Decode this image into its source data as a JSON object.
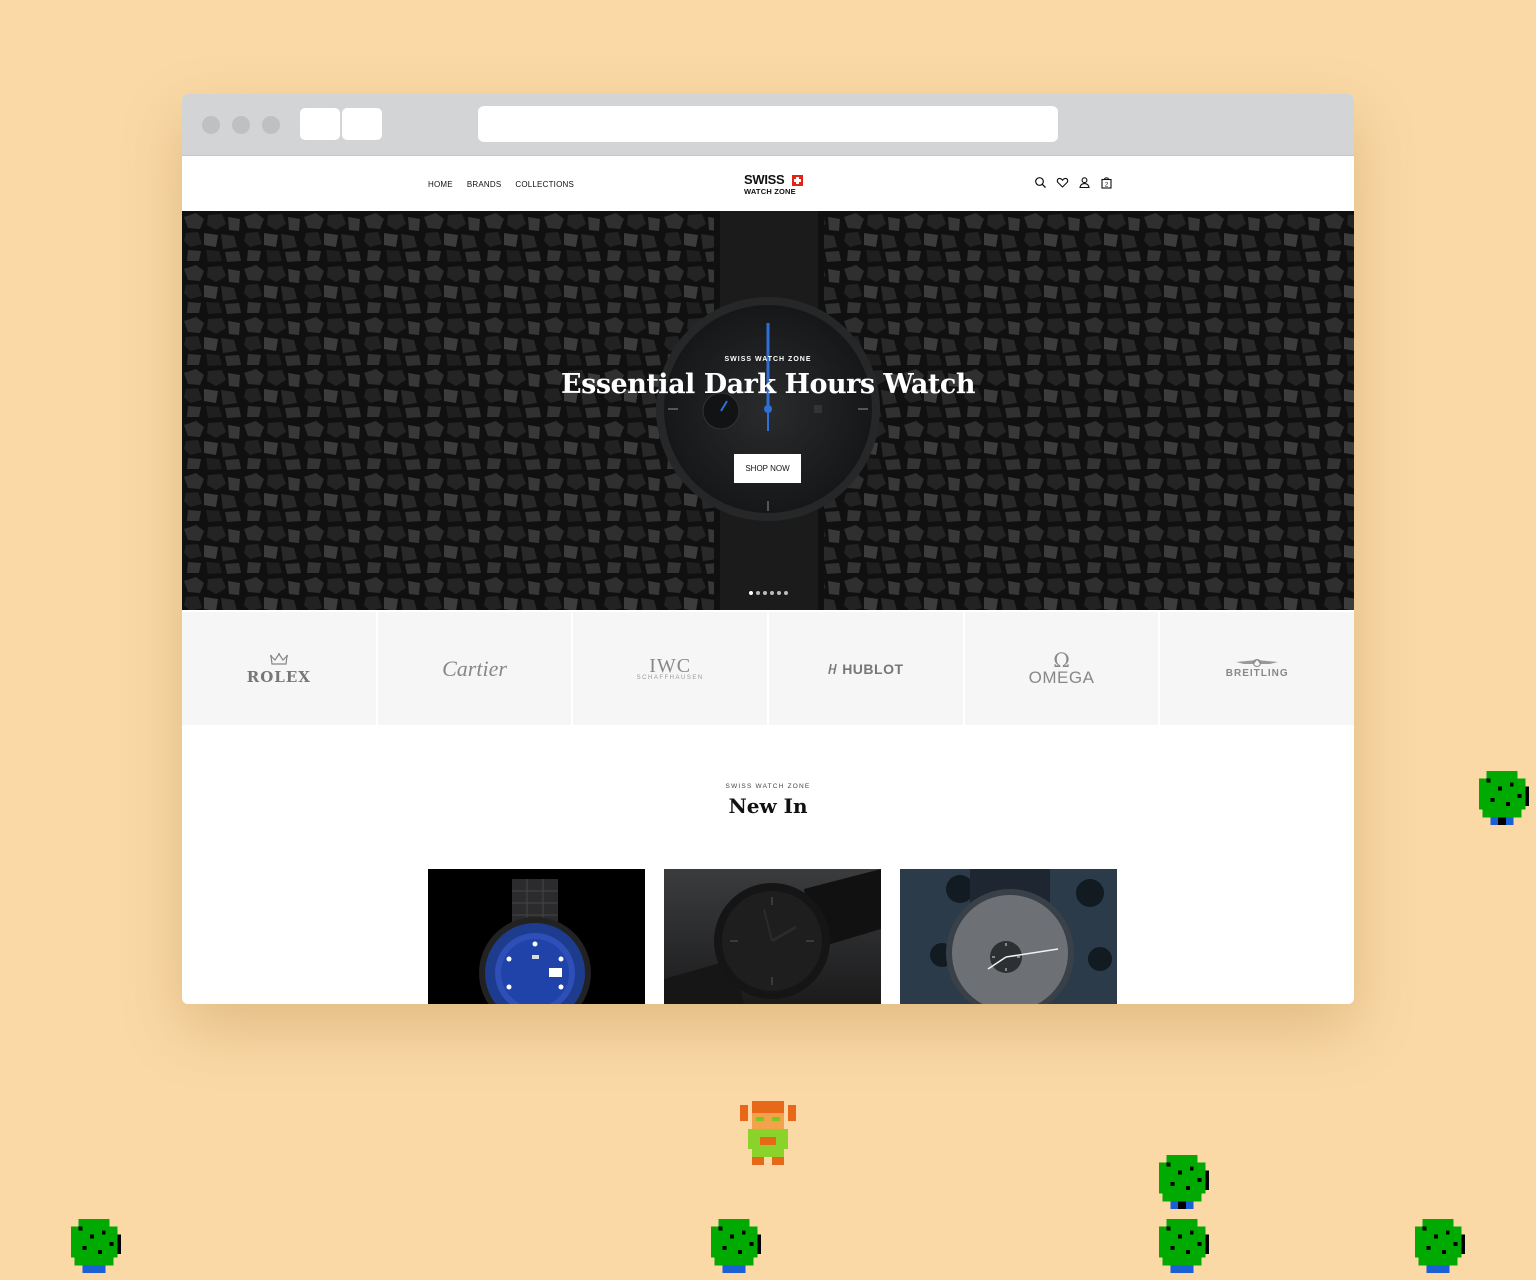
{
  "site": {
    "logo_line1": "SWISS",
    "logo_line2": "WATCH ZONE",
    "nav": [
      "HOME",
      "BRANDS",
      "COLLECTIONS"
    ],
    "cart_count": "2"
  },
  "hero": {
    "eyebrow": "SWISS WATCH ZONE",
    "title": "Essential Dark Hours Watch",
    "cta": "SHOP NOW",
    "slide_count": 6,
    "active_slide": 1
  },
  "brands": {
    "rolex": "ROLEX",
    "cartier": "Cartier",
    "iwc": "IWC",
    "iwc_sub": "SCHAFFHAUSEN",
    "hublot": "HUBLOT",
    "omega_symbol": "Ω",
    "omega": "OMEGA",
    "breitling": "BREITLING"
  },
  "new_in": {
    "eyebrow": "SWISS WATCH ZONE",
    "title": "New In"
  },
  "colors": {
    "background": "#fad9a6",
    "hero_dark": "#151515",
    "flag_red": "#e2231a",
    "accent_blue": "#2f6fd6"
  }
}
